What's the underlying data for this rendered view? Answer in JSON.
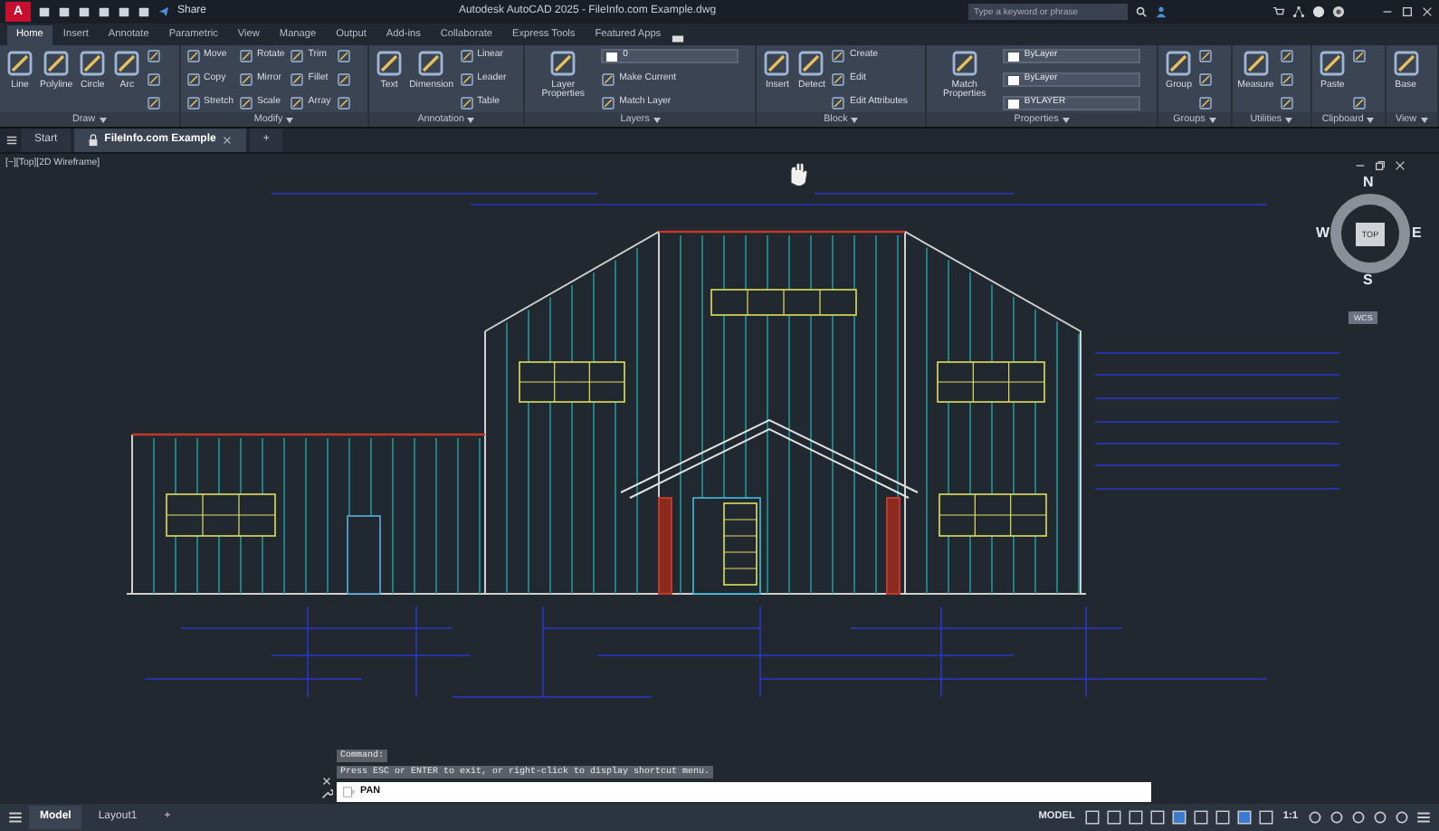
{
  "title_bar": {
    "app_menu": "A",
    "share": "Share",
    "title": "Autodesk AutoCAD 2025 - FileInfo.com Example.dwg",
    "search": {
      "placeholder": "Type a keyword or phrase"
    }
  },
  "ribbon_tabs": [
    {
      "label": "Home",
      "selected": true
    },
    {
      "label": "Insert",
      "selected": false
    },
    {
      "label": "Annotate",
      "selected": false
    },
    {
      "label": "Parametric",
      "selected": false
    },
    {
      "label": "View",
      "selected": false
    },
    {
      "label": "Manage",
      "selected": false
    },
    {
      "label": "Output",
      "selected": false
    },
    {
      "label": "Add-ins",
      "selected": false
    },
    {
      "label": "Collaborate",
      "selected": false
    },
    {
      "label": "Express Tools",
      "selected": false
    },
    {
      "label": "Featured Apps",
      "selected": false
    }
  ],
  "ribbon_panels": [
    {
      "title": "Draw",
      "columns": [
        [
          {
            "kind": "large",
            "label": "Line"
          }
        ],
        [
          {
            "kind": "large",
            "label": "Polyline"
          }
        ],
        [
          {
            "kind": "large",
            "label": "Circle"
          }
        ],
        [
          {
            "kind": "large",
            "label": "Arc"
          }
        ],
        [
          {
            "kind": "icon"
          },
          {
            "kind": "icon"
          },
          {
            "kind": "icon"
          }
        ]
      ]
    },
    {
      "title": "Modify",
      "columns": [
        [
          {
            "kind": "small",
            "label": "Move"
          },
          {
            "kind": "small",
            "label": "Copy"
          },
          {
            "kind": "small",
            "label": "Stretch"
          }
        ],
        [
          {
            "kind": "small",
            "label": "Rotate"
          },
          {
            "kind": "small",
            "label": "Mirror"
          },
          {
            "kind": "small",
            "label": "Scale"
          }
        ],
        [
          {
            "kind": "small",
            "label": "Trim"
          },
          {
            "kind": "small",
            "label": "Fillet"
          },
          {
            "kind": "small",
            "label": "Array"
          }
        ],
        [
          {
            "kind": "icon"
          },
          {
            "kind": "icon"
          },
          {
            "kind": "icon"
          }
        ]
      ]
    },
    {
      "title": "Annotation",
      "columns": [
        [
          {
            "kind": "large",
            "label": "Text"
          }
        ],
        [
          {
            "kind": "large",
            "label": "Dimension"
          }
        ],
        [
          {
            "kind": "small",
            "label": "Linear"
          },
          {
            "kind": "small",
            "label": "Leader"
          },
          {
            "kind": "small",
            "label": "Table"
          }
        ]
      ]
    },
    {
      "title": "Layers",
      "columns": [
        [
          {
            "kind": "large",
            "label": "Layer Properties"
          }
        ],
        [
          {
            "kind": "combo",
            "value": "0"
          },
          {
            "kind": "small",
            "label": "Make Current"
          },
          {
            "kind": "small",
            "label": "Match Layer"
          }
        ]
      ]
    },
    {
      "title": "Block",
      "columns": [
        [
          {
            "kind": "large",
            "label": "Insert"
          }
        ],
        [
          {
            "kind": "large",
            "label": "Detect"
          }
        ],
        [
          {
            "kind": "small",
            "label": "Create"
          },
          {
            "kind": "small",
            "label": "Edit"
          },
          {
            "kind": "small",
            "label": "Edit Attributes"
          }
        ]
      ]
    },
    {
      "title": "Properties",
      "columns": [
        [
          {
            "kind": "large",
            "label": "Match Properties"
          }
        ],
        [
          {
            "kind": "combo",
            "value": "ByLayer"
          },
          {
            "kind": "combo",
            "value": "ByLayer"
          },
          {
            "kind": "combo",
            "value": "BYLAYER"
          }
        ]
      ]
    },
    {
      "title": "Groups",
      "columns": [
        [
          {
            "kind": "large",
            "label": "Group"
          }
        ],
        [
          {
            "kind": "icon"
          },
          {
            "kind": "icon"
          },
          {
            "kind": "icon"
          }
        ]
      ]
    },
    {
      "title": "Utilities",
      "columns": [
        [
          {
            "kind": "large",
            "label": "Measure"
          }
        ],
        [
          {
            "kind": "icon"
          },
          {
            "kind": "icon"
          },
          {
            "kind": "icon"
          }
        ]
      ]
    },
    {
      "title": "Clipboard",
      "columns": [
        [
          {
            "kind": "large",
            "label": "Paste"
          }
        ],
        [
          {
            "kind": "icon"
          },
          {
            "kind": "icon"
          }
        ]
      ]
    },
    {
      "title": "View",
      "columns": [
        [
          {
            "kind": "large",
            "label": "Base"
          }
        ]
      ]
    }
  ],
  "file_tabs": [
    {
      "label": "Start",
      "selected": false
    },
    {
      "label": "FileInfo.com Example",
      "selected": true
    },
    {
      "label": "+",
      "selected": false
    }
  ],
  "viewport": {
    "label": "[−][Top][2D Wireframe]",
    "viewcube": {
      "north": "N",
      "west": "W",
      "east": "E",
      "south": "S",
      "face": "TOP",
      "ucs": "WCS"
    }
  },
  "command_line": {
    "history": [
      "Command:",
      "Press ESC or ENTER to exit, or right-click to display shortcut menu."
    ],
    "input": "PAN"
  },
  "status_bar": {
    "layout_tabs": [
      {
        "label": "Model",
        "selected": true
      },
      {
        "label": "Layout1",
        "selected": false
      },
      {
        "label": "+",
        "selected": false
      }
    ],
    "space": "MODEL",
    "scale": "1:1"
  }
}
